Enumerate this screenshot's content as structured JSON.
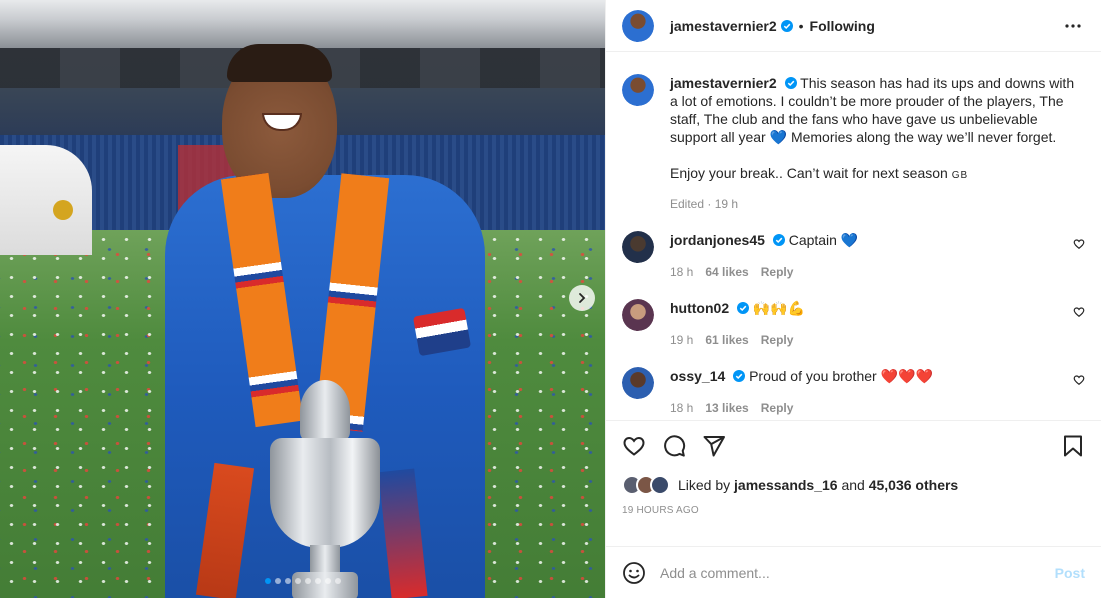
{
  "header": {
    "username": "jamestavernier2",
    "separator": "•",
    "follow_label": "Following"
  },
  "caption": {
    "username": "jamestavernier2",
    "text_1": "This season has had its ups and downs with a lot of emotions. I couldn’t be more prouder of the players, The staff, The club and the fans who have gave us unbelievable support all year",
    "heart": "💙",
    "text_2": "Memories along the way we’ll never forget.",
    "text_3": "Enjoy your break.. Can’t wait for next season",
    "flag": "GB",
    "meta": "Edited · 19 h"
  },
  "comments": [
    {
      "username": "jordanjones45",
      "text": "Captain 💙",
      "age": "18 h",
      "likes": "64 likes",
      "reply": "Reply"
    },
    {
      "username": "hutton02",
      "text": "🙌🙌💪",
      "age": "19 h",
      "likes": "61 likes",
      "reply": "Reply"
    },
    {
      "username": "ossy_14",
      "text": "Proud of you brother ❤️❤️❤️",
      "age": "18 h",
      "likes": "13 likes",
      "reply": "Reply"
    }
  ],
  "likes": {
    "prefix": "Liked by",
    "user": "jamessands_16",
    "middle": "and",
    "others": "45,036 others"
  },
  "timestamp": "19 HOURS AGO",
  "compose": {
    "placeholder": "Add a comment...",
    "post_label": "Post"
  },
  "carousel": {
    "total": 8,
    "active": 1
  },
  "colors": {
    "verified": "#0095f6",
    "heart_red": "#ed4956",
    "link_blue": "#0095f6",
    "post_disabled": "#b2dffc"
  },
  "icons": [
    "more-icon",
    "verified-icon",
    "heart-icon",
    "comment-icon",
    "share-icon",
    "bookmark-icon",
    "emoji-icon",
    "chevron-right-icon"
  ]
}
